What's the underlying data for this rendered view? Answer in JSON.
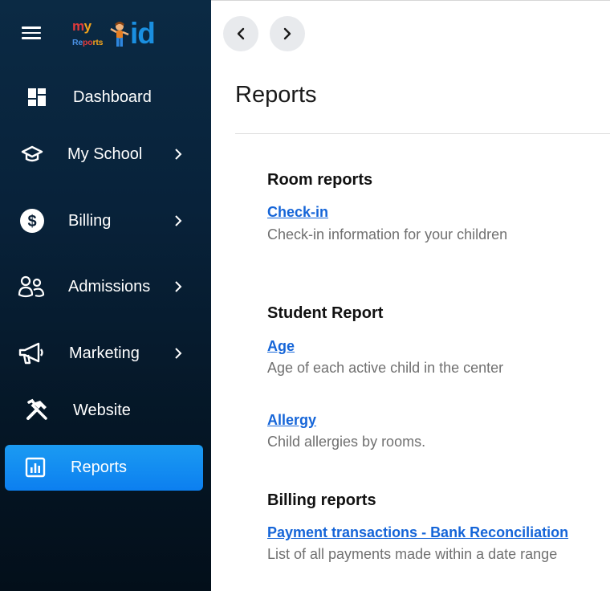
{
  "logo": {
    "text_my_m": "m",
    "text_my_y": "y",
    "text_reports_1": "Re",
    "text_reports_2": "po",
    "text_reports_3": "rts",
    "text_kid": "id"
  },
  "sidebar": {
    "items": [
      {
        "label": "Dashboard",
        "icon": "dashboard-icon",
        "has_chevron": false
      },
      {
        "label": "My School",
        "icon": "graduation-cap-icon",
        "has_chevron": true
      },
      {
        "label": "Billing",
        "icon": "dollar-circle-icon",
        "has_chevron": true
      },
      {
        "label": "Admissions",
        "icon": "users-icon",
        "has_chevron": true
      },
      {
        "label": "Marketing",
        "icon": "megaphone-icon",
        "has_chevron": true
      },
      {
        "label": "Website",
        "icon": "tools-icon",
        "has_chevron": false
      },
      {
        "label": "Reports",
        "icon": "bar-chart-icon",
        "has_chevron": false,
        "active": true
      }
    ]
  },
  "header": {
    "back_icon": "chevron-left-icon",
    "forward_icon": "chevron-right-icon"
  },
  "main": {
    "title": "Reports",
    "sections": [
      {
        "heading": "Room reports",
        "reports": [
          {
            "link": "Check-in",
            "description": "Check-in information for your children"
          }
        ]
      },
      {
        "heading": "Student Report",
        "reports": [
          {
            "link": "Age",
            "description": "Age of each active child in the center"
          },
          {
            "link": "Allergy",
            "description": "Child allergies by rooms."
          }
        ]
      },
      {
        "heading": "Billing reports",
        "reports": [
          {
            "link": "Payment transactions - Bank Reconciliation",
            "description": "List of all payments made within a date range"
          }
        ]
      }
    ]
  },
  "colors": {
    "sidebar_top": "#0b2a44",
    "sidebar_bottom": "#030f1a",
    "active_item": "#1b9bf2",
    "link": "#1565d8",
    "description": "#707070"
  }
}
